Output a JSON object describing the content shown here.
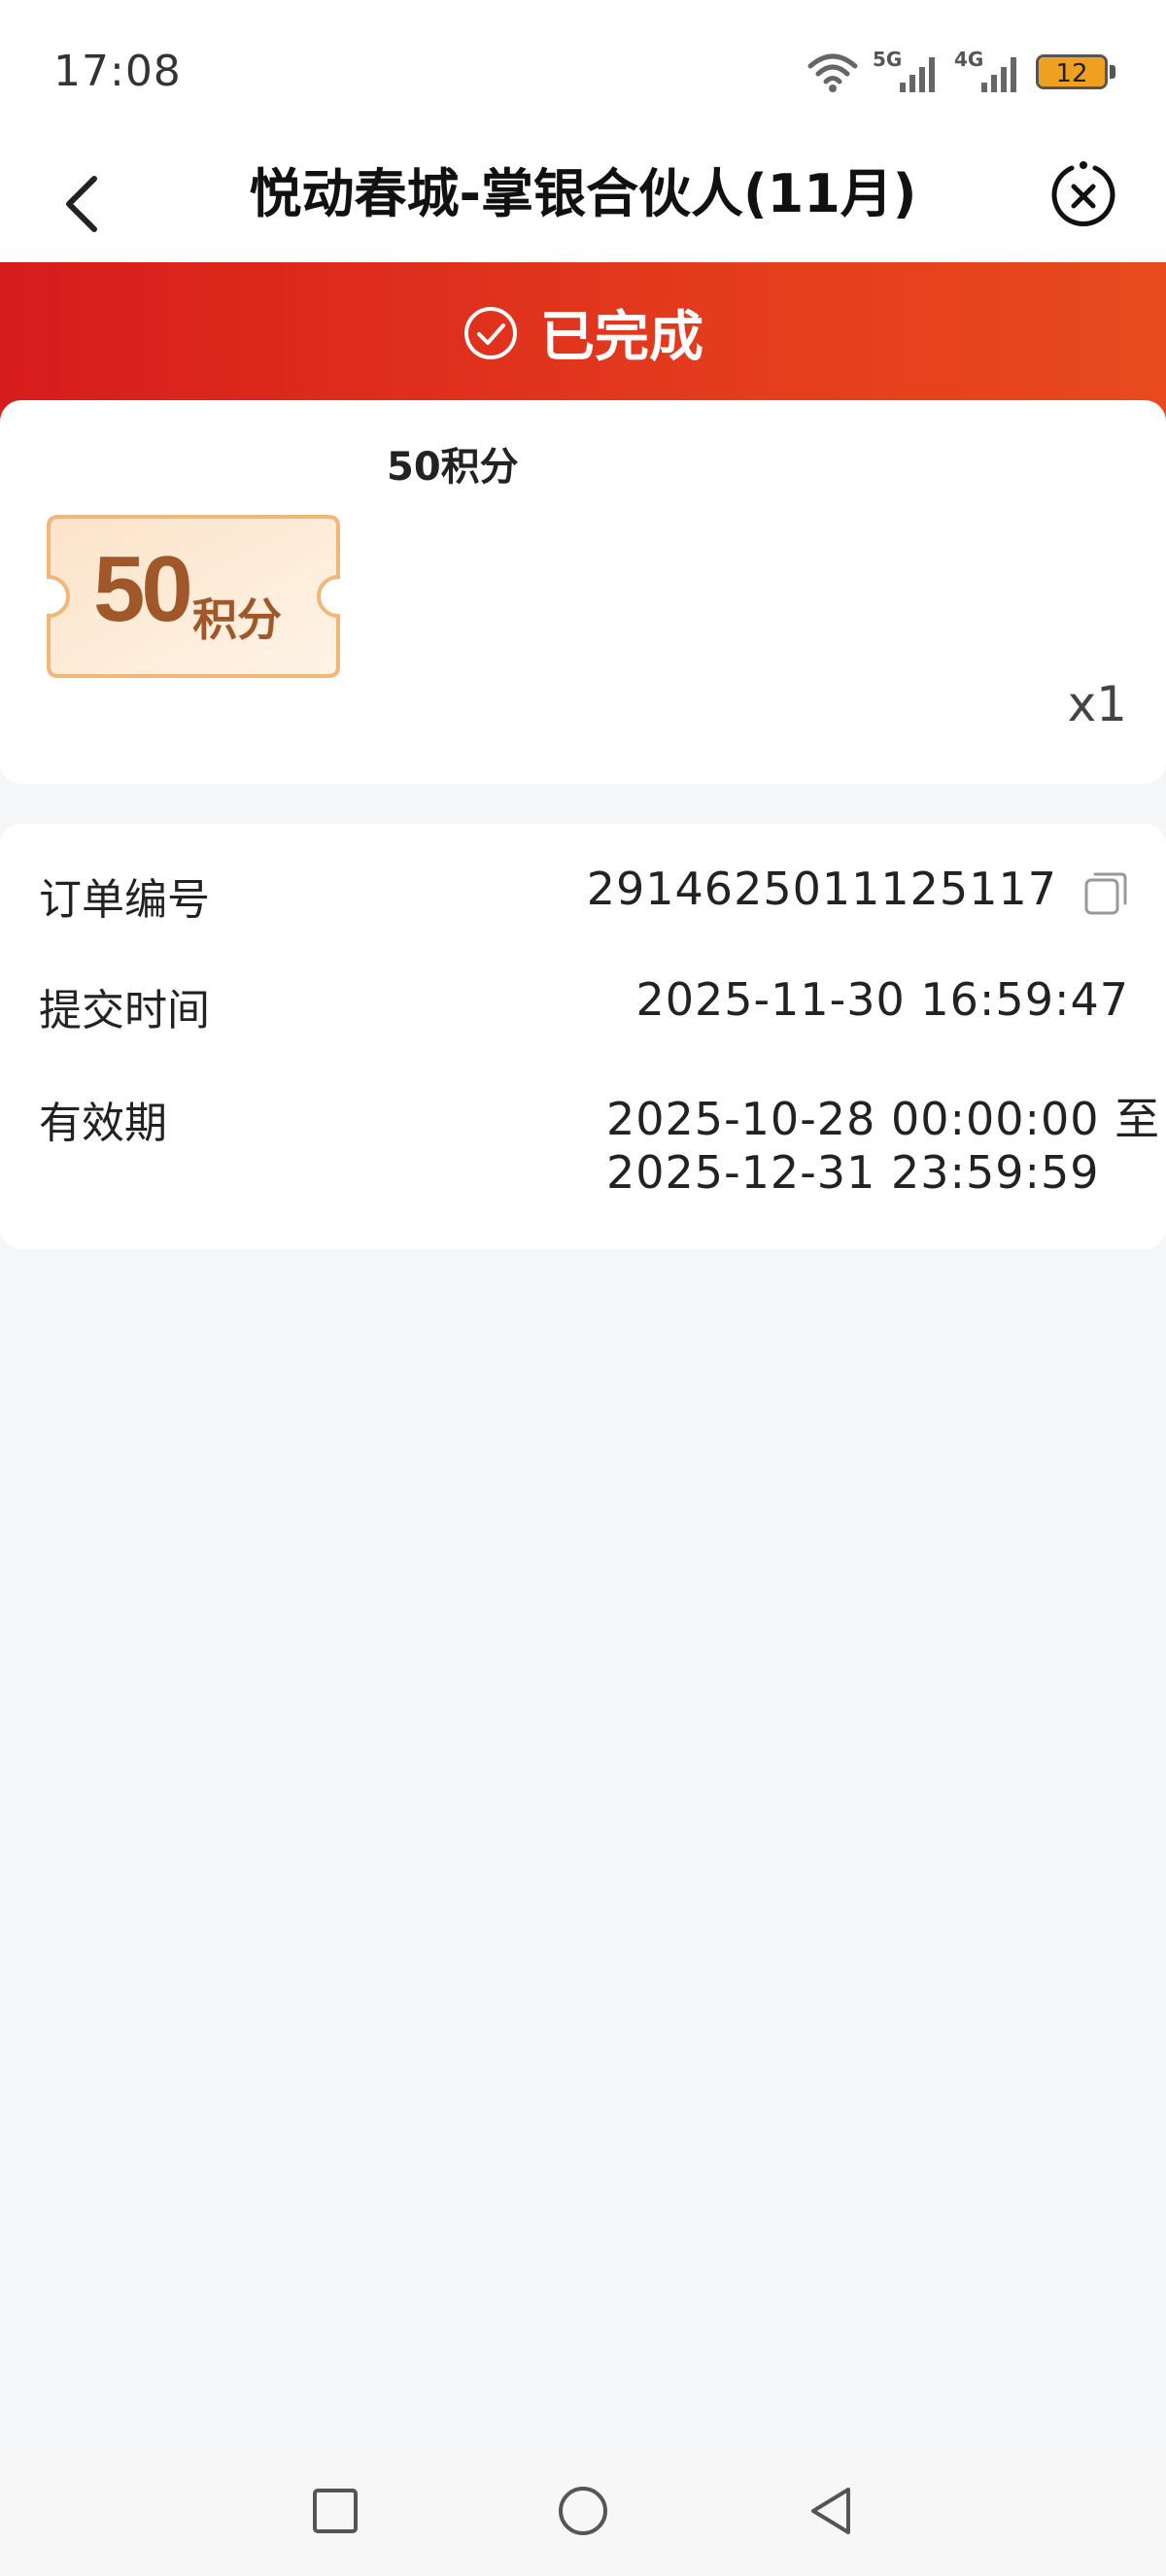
{
  "status_bar": {
    "time": "17:08",
    "network_1": "5G",
    "network_2": "4G",
    "battery": "12",
    "battery_color": "#f0a020"
  },
  "navbar": {
    "title": "悦动春城-掌银合伙人(11月)",
    "back_icon": "chevron-left-icon",
    "close_icon": "close-circle-icon"
  },
  "banner": {
    "status": "已完成",
    "icon": "check-circle-icon",
    "color": "#d71c1c"
  },
  "product": {
    "name": "50积分",
    "voucher_amount": "50",
    "voucher_unit": "积分",
    "quantity": "x1"
  },
  "order_info": {
    "order_no_label": "订单编号",
    "order_no": "2914625011125117",
    "submit_time_label": "提交时间",
    "submit_time": "2025-11-30 16:59:47",
    "validity_label": "有效期",
    "validity_line1": "2025-10-28 00:00:00 至",
    "validity_line2": "2025-12-31 23:59:59",
    "copy_icon": "copy-icon"
  },
  "system_nav": {
    "recent_icon": "square-icon",
    "home_icon": "circle-icon",
    "back_icon": "triangle-back-icon"
  }
}
